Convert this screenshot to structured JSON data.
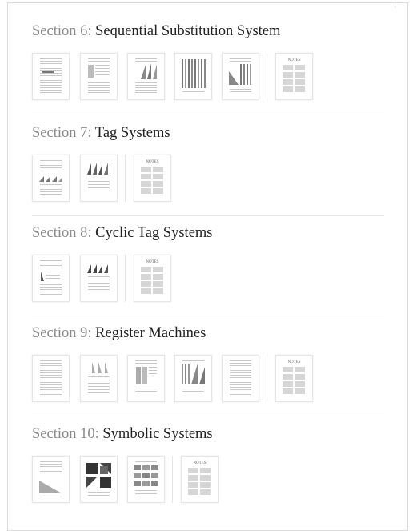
{
  "sections": [
    {
      "label": "Section 6:",
      "title": "Sequential Substitution System"
    },
    {
      "label": "Section 7:",
      "title": "Tag Systems"
    },
    {
      "label": "Section 8:",
      "title": "Cyclic Tag Systems"
    },
    {
      "label": "Section 9:",
      "title": "Register Machines"
    },
    {
      "label": "Section 10:",
      "title": "Symbolic Systems"
    }
  ],
  "notes_label": "NOTES"
}
